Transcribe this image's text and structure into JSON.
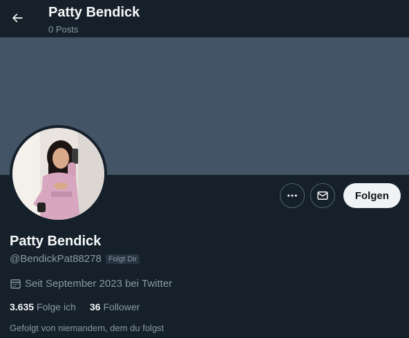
{
  "header": {
    "name": "Patty Bendick",
    "posts": "0 Posts"
  },
  "profile": {
    "name": "Patty Bendick",
    "handle": "@BendickPat88278",
    "follows_you_badge": "Folgt Dir",
    "joined": "Seit September 2023 bei Twitter",
    "following_count": "3.635",
    "following_label": "Folge ich",
    "followers_count": "36",
    "followers_label": "Follower",
    "followed_by_text": "Gefolgt von niemandem, dem du folgst"
  },
  "actions": {
    "more_icon": "more-dots-icon",
    "message_icon": "envelope-icon",
    "follow_label": "Folgen"
  },
  "colors": {
    "background": "#15202b",
    "banner": "#425466",
    "secondary_text": "#8b98a5",
    "follow_button_bg": "#eff3f4"
  }
}
